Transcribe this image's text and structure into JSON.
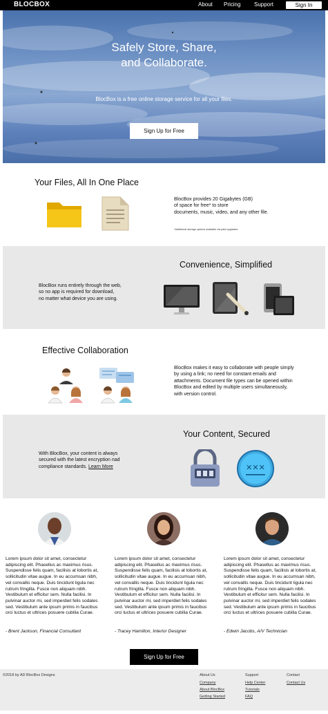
{
  "nav": {
    "brand": "BLOCBOX",
    "links": [
      "About",
      "Pricing",
      "Support"
    ],
    "signin": "Sign In"
  },
  "hero": {
    "title_line1": "Safely Store, Share,",
    "title_line2": "and Collaborate.",
    "subtitle": "BlocBox is a free online storage service for all your files.",
    "cta": "Sign Up for Free"
  },
  "files": {
    "title": "Your Files, All In One Place",
    "line1": "BlocBox provides 20 Gigabytes (GB)",
    "line2": "of space for free* to store",
    "line3": "documents, music, video, and any other file.",
    "note": "*Additional storage options available via paid upgrades.",
    "icons": [
      "folder-icon",
      "document-icon"
    ]
  },
  "convenience": {
    "title": "Convenience, Simplified",
    "line1": "BlocBox runs entirely through the web,",
    "line2": "so no app is required for download,",
    "line3": "no matter what device you are using.",
    "icons": [
      "desktop-icon",
      "tablet-icon",
      "phone-tablet-icon"
    ]
  },
  "collaboration": {
    "title": "Effective Collaboration",
    "line1": "BlocBox makes it easy to collaborate with people simply",
    "line2": "by using a link; no need for constant emails and",
    "line3": "attachments. Document file types can be opened within",
    "line4": "BlocBox and edited by multiple users simultaneously,",
    "line5": "with version control.",
    "icons": [
      "team-icon",
      "chat-team-icon"
    ]
  },
  "security": {
    "title": "Your Content, Secured",
    "line1": "With BlocBox, your content is always",
    "line2": "secured with the latest encryption nad",
    "line3": "compliance standards.",
    "learn_more": "Learn More",
    "icons": [
      "padlock-icon",
      "password-icon"
    ]
  },
  "testimonials": [
    {
      "text": "Lorem ipsum dolor sit amet, consectetur adipiscing elit. Phasellus ac maximus risus. Suspendisse felis quam, facilisis at lobortis at, sollicitudin vitae augue. In eu accumsan nibh, vel convallis neque. Duis tincidunt ligula nec rutrum fringilla. Fusce non aliquam nibh. Vestibulum et efficitur sem. Nulla facilisi. In pulvinar auctor mi, sed imperdiet felis sodales sed. Vestibulum ante ipsum primis in faucibus orci luctus et ultrices posuere cubilia Curae.",
      "author": "- Brent Jackson, Financial Consultant"
    },
    {
      "text": "Lorem ipsum dolor sit amet, consectetur adipiscing elit. Phasellus ac maximus risus. Suspendisse felis quam, facilisis at lobortis at, sollicitudin vitae augue. In eu accumsan nibh, vel convallis neque. Duis tincidunt ligula nec rutrum fringilla. Fusce non aliquam nibh. Vestibulum et efficitur sem. Nulla facilisi. In pulvinar auctor mi, sed imperdiet felis sodales sed. Vestibulum ante ipsum primis in faucibus orci luctus et ultrices posuere cubilia Curae.",
      "author": "- Tracey Hamilton, Interior Designer"
    },
    {
      "text": "Lorem ipsum dolor sit amet, consectetur adipiscing elit. Phasellus ac maximus risus. Suspendisse felis quam, facilisis at lobortis at, sollicitudin vitae augue. In eu accumsan nibh, vel convallis neque. Duis tincidunt ligula nec rutrum fringilla. Fusce non aliquam nibh. Vestibulum et efficitur sem. Nulla facilisi. In pulvinar auctor mi, sed imperdiet felis sodales sed. Vestibulum ante ipsum primis in faucibus orci luctus et ultrices posuere cubilia Curae.",
      "author": "- Edwin Jacobs, A/V Technician"
    }
  ],
  "bottom_cta": "Sign Up for Free",
  "footer": {
    "copyright": "©2018 by AD BlocBox Designs",
    "about": {
      "heading": "About Us",
      "links": [
        "Company",
        "About BlocBox",
        "Getting Started"
      ]
    },
    "support": {
      "heading": "Support",
      "links": [
        "Help Center",
        "Tutorials",
        "FAQ"
      ]
    },
    "contact": {
      "heading": "Contact",
      "links": [
        "Contact Us"
      ]
    }
  },
  "colors": {
    "nav_bg": "#000000",
    "section_gray": "#e8e8e8",
    "folder_yellow": "#f5c518",
    "icon_blue": "#4aa3df"
  }
}
